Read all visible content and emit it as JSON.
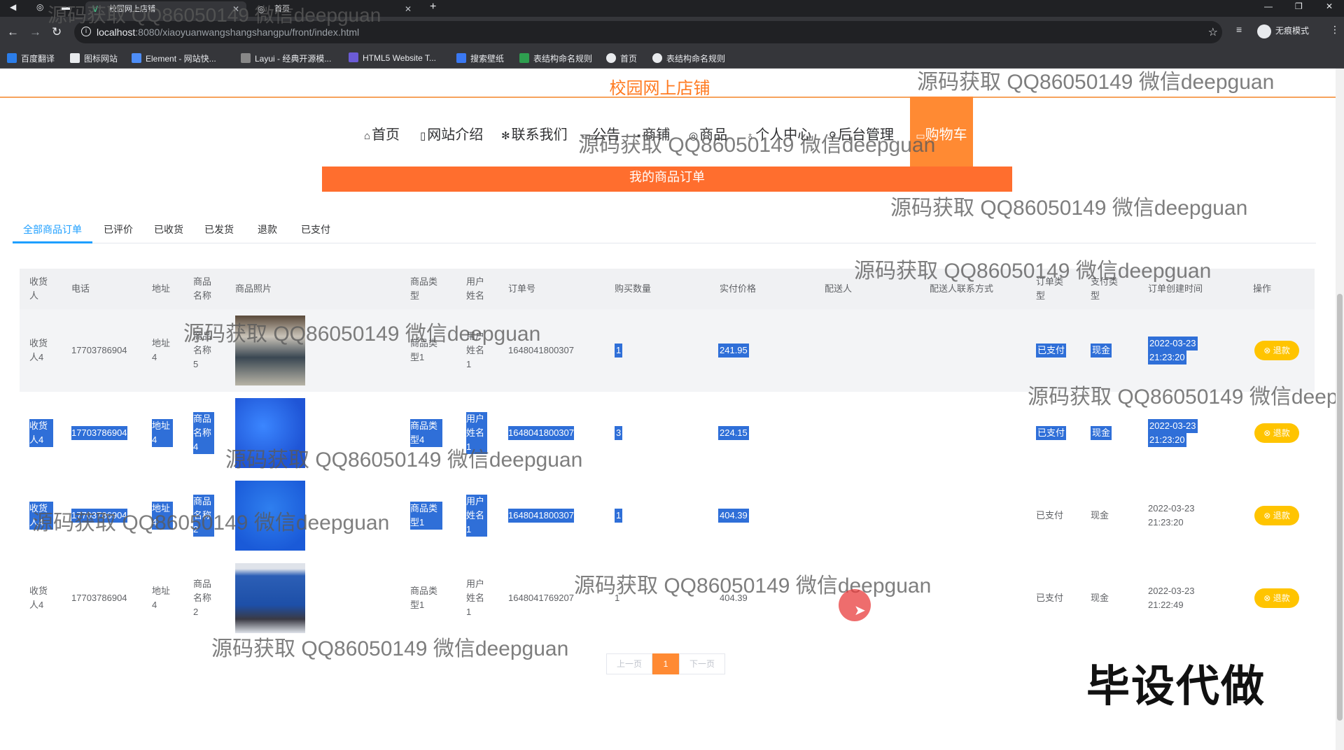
{
  "browser": {
    "tabs": [
      {
        "title": "校园网上店铺",
        "icon": "vue-icon"
      },
      {
        "title": "首页",
        "icon": "globe-icon"
      }
    ],
    "url_host": "localhost",
    "url_path": ":8080/xiaoyuanwangshangshangpu/front/index.html",
    "profile_label": "无痕模式",
    "bookmarks": [
      "百度翻译",
      "图标网站",
      "Element - 网站快...",
      "Layui - 经典开源模...",
      "HTML5 Website T...",
      "搜索壁纸",
      "表结构命名规则",
      "首页",
      "表结构命名规则"
    ]
  },
  "site": {
    "title": "校园网上店铺",
    "nav": [
      {
        "label": "首页",
        "icon": "home-icon"
      },
      {
        "label": "网站介绍",
        "icon": "doc-icon"
      },
      {
        "label": "联系我们",
        "icon": "gear-icon"
      },
      {
        "label": "公告",
        "icon": "bell-icon"
      },
      {
        "label": "商铺",
        "icon": "shop-icon"
      },
      {
        "label": "商品",
        "icon": "goods-icon"
      },
      {
        "label": "个人中心",
        "icon": "user-icon"
      },
      {
        "label": "后台管理",
        "icon": "link-icon"
      }
    ],
    "cart_label": "购物车",
    "banner": "我的商品订单"
  },
  "order_tabs": [
    "全部商品订单",
    "已评价",
    "已收货",
    "已发货",
    "退款",
    "已支付"
  ],
  "table": {
    "headers": [
      "收货人",
      "电话",
      "地址",
      "商品名称",
      "商品照片",
      "商品类型",
      "用户姓名",
      "订单号",
      "购买数量",
      "实付价格",
      "配送人",
      "配送人联系方式",
      "订单类型",
      "支付类型",
      "订单创建时间",
      "操作"
    ],
    "rows": [
      {
        "consignee": "收货人4",
        "phone": "17703786904",
        "address": "地址4",
        "product": "商品名称5",
        "category": "商品类型1",
        "user": "用户姓名1",
        "order_no": "1648041800307",
        "qty": "1",
        "price": "241.95",
        "courier": "",
        "courier_phone": "",
        "order_type": "已支付",
        "pay_type": "现金",
        "created_date": "2022-03-23",
        "created_time": "21:23:20",
        "action": "退款"
      },
      {
        "consignee": "收货人4",
        "phone": "17703786904",
        "address": "地址4",
        "product": "商品名称4",
        "category": "商品类型4",
        "user": "用户姓名1",
        "order_no": "1648041800307",
        "qty": "3",
        "price": "224.15",
        "courier": "",
        "courier_phone": "",
        "order_type": "已支付",
        "pay_type": "现金",
        "created_date": "2022-03-23",
        "created_time": "21:23:20",
        "action": "退款"
      },
      {
        "consignee": "收货人4",
        "phone": "17703786904",
        "address": "地址4",
        "product": "商品名称2",
        "category": "商品类型1",
        "user": "用户姓名1",
        "order_no": "1648041800307",
        "qty": "1",
        "price": "404.39",
        "courier": "",
        "courier_phone": "",
        "order_type": "已支付",
        "pay_type": "现金",
        "created_date": "2022-03-23",
        "created_time": "21:23:20",
        "action": "退款"
      },
      {
        "consignee": "收货人4",
        "phone": "17703786904",
        "address": "地址4",
        "product": "商品名称2",
        "category": "商品类型1",
        "user": "用户姓名1",
        "order_no": "1648041769207",
        "qty": "1",
        "price": "404.39",
        "courier": "",
        "courier_phone": "",
        "order_type": "已支付",
        "pay_type": "现金",
        "created_date": "2022-03-23",
        "created_time": "21:22:49",
        "action": "退款"
      }
    ]
  },
  "pagination": {
    "prev": "上一页",
    "current": "1",
    "next": "下一页"
  },
  "watermark": {
    "text": "源码获取 QQ86050149 微信deepguan",
    "big": "毕设代做"
  },
  "colors": {
    "accent": "#ff8a33",
    "banner": "#ff6e2e",
    "tab_active": "#1e9fff",
    "refund": "#ffc400",
    "selection": "#2f6fd8"
  }
}
